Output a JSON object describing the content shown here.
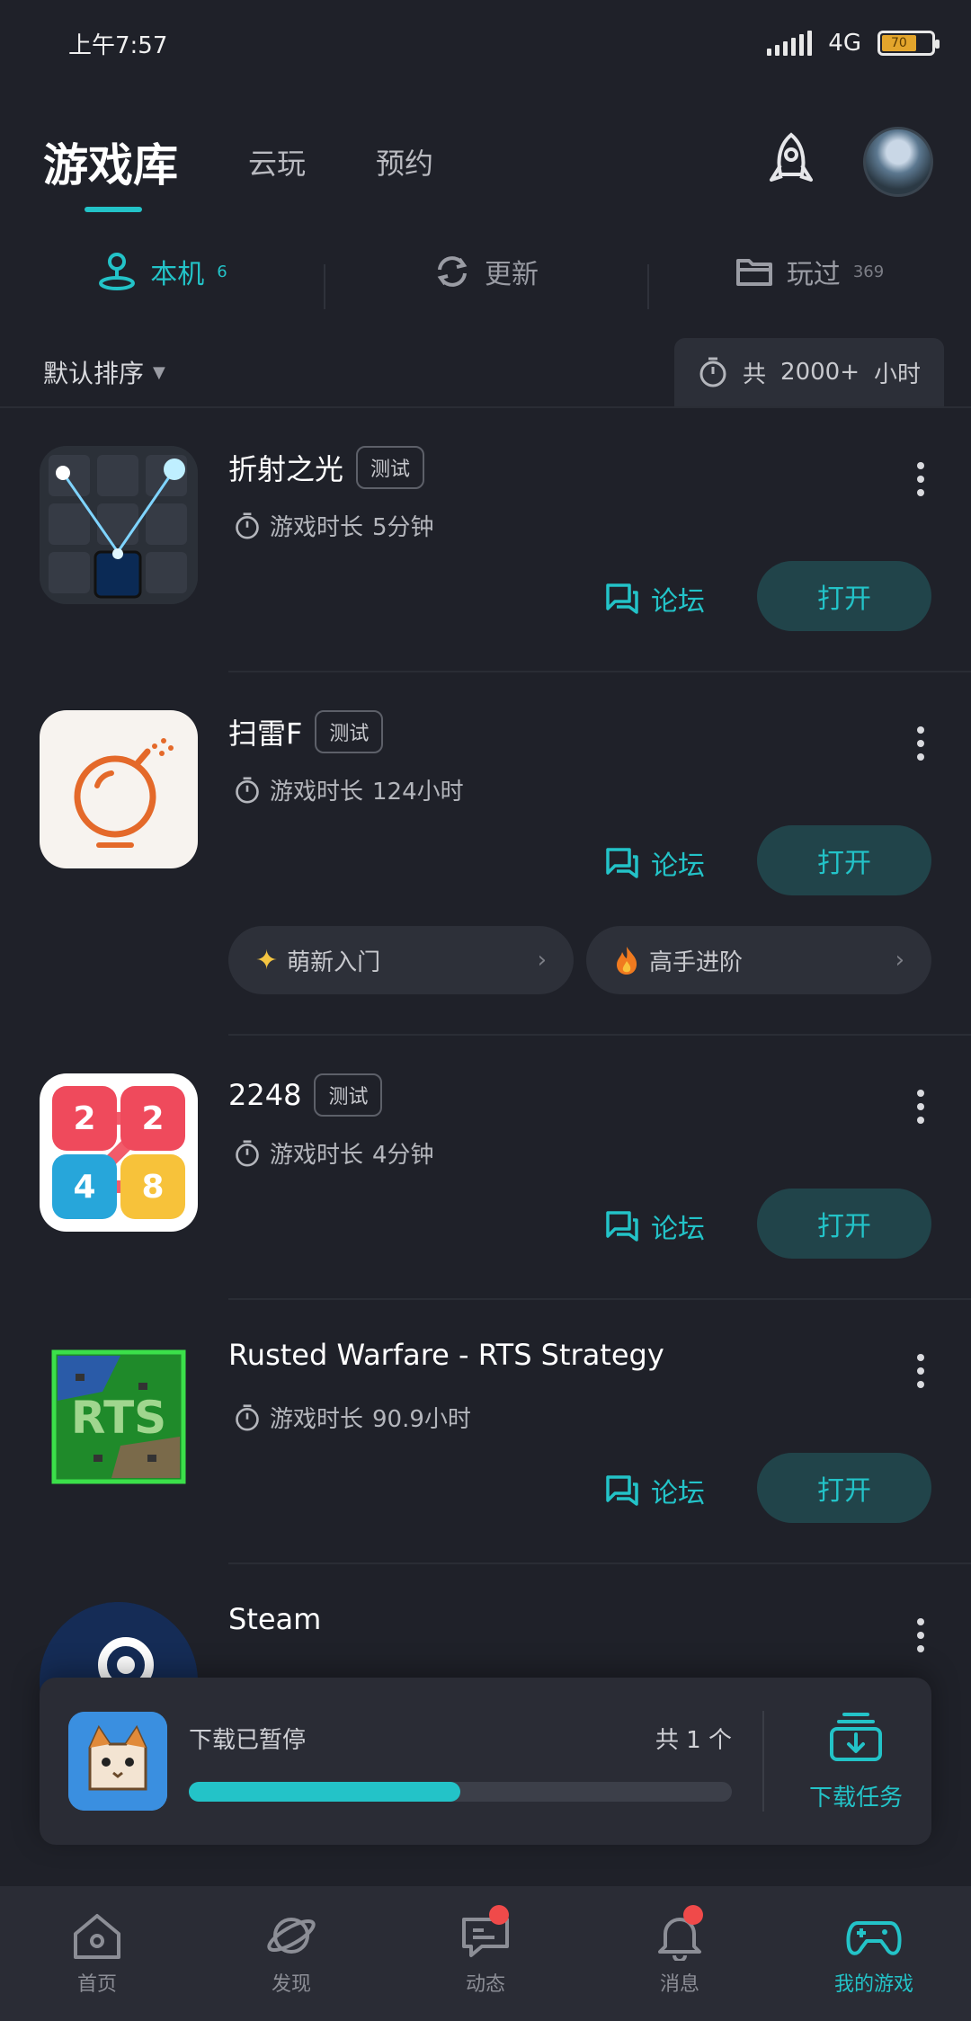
{
  "status_bar": {
    "time": "上午7:57",
    "network": "4G",
    "battery": "70"
  },
  "top_tabs": [
    {
      "label": "游戏库",
      "active": true
    },
    {
      "label": "云玩",
      "active": false
    },
    {
      "label": "预约",
      "active": false
    }
  ],
  "sub_tabs": [
    {
      "label": "本机",
      "count": "6",
      "icon": "joystick-icon",
      "active": true
    },
    {
      "label": "更新",
      "count": "",
      "icon": "refresh-icon",
      "active": false
    },
    {
      "label": "玩过",
      "count": "369",
      "icon": "folder-icon",
      "active": false
    }
  ],
  "sort": {
    "label": "默认排序",
    "total_prefix": "共",
    "total_value": "2000+",
    "total_unit": "小时"
  },
  "games": [
    {
      "title": "折射之光",
      "tag": "测试",
      "playtime_label": "游戏时长",
      "playtime": "5分钟",
      "forum": "论坛",
      "open": "打开"
    },
    {
      "title": "扫雷F",
      "tag": "测试",
      "playtime_label": "游戏时长",
      "playtime": "124小时",
      "forum": "论坛",
      "open": "打开",
      "guides": [
        "萌新入门",
        "高手进阶"
      ]
    },
    {
      "title": "2248",
      "tag": "测试",
      "playtime_label": "游戏时长",
      "playtime": "4分钟",
      "forum": "论坛",
      "open": "打开"
    },
    {
      "title": "Rusted Warfare - RTS Strategy",
      "tag": "",
      "playtime_label": "游戏时长",
      "playtime": "90.9小时",
      "forum": "论坛",
      "open": "打开"
    },
    {
      "title": "Steam",
      "tag": ""
    }
  ],
  "icon_text": {
    "2248_tiles": [
      "2",
      "2",
      "4",
      "8"
    ],
    "rts": "RTS"
  },
  "download": {
    "status": "下载已暂停",
    "count_label": "共 1 个",
    "progress": 0.5,
    "tasks_label": "下载任务"
  },
  "bottom_nav": [
    {
      "label": "首页",
      "icon": "home-icon",
      "active": false,
      "badge": false
    },
    {
      "label": "发现",
      "icon": "planet-icon",
      "active": false,
      "badge": false
    },
    {
      "label": "动态",
      "icon": "chat-icon",
      "active": false,
      "badge": true
    },
    {
      "label": "消息",
      "icon": "bell-icon",
      "active": false,
      "badge": true
    },
    {
      "label": "我的游戏",
      "icon": "gamepad-icon",
      "active": true,
      "badge": false
    }
  ],
  "colors": {
    "accent": "#23c3c8",
    "background": "#1f2129",
    "badge": "#f04a4a"
  }
}
